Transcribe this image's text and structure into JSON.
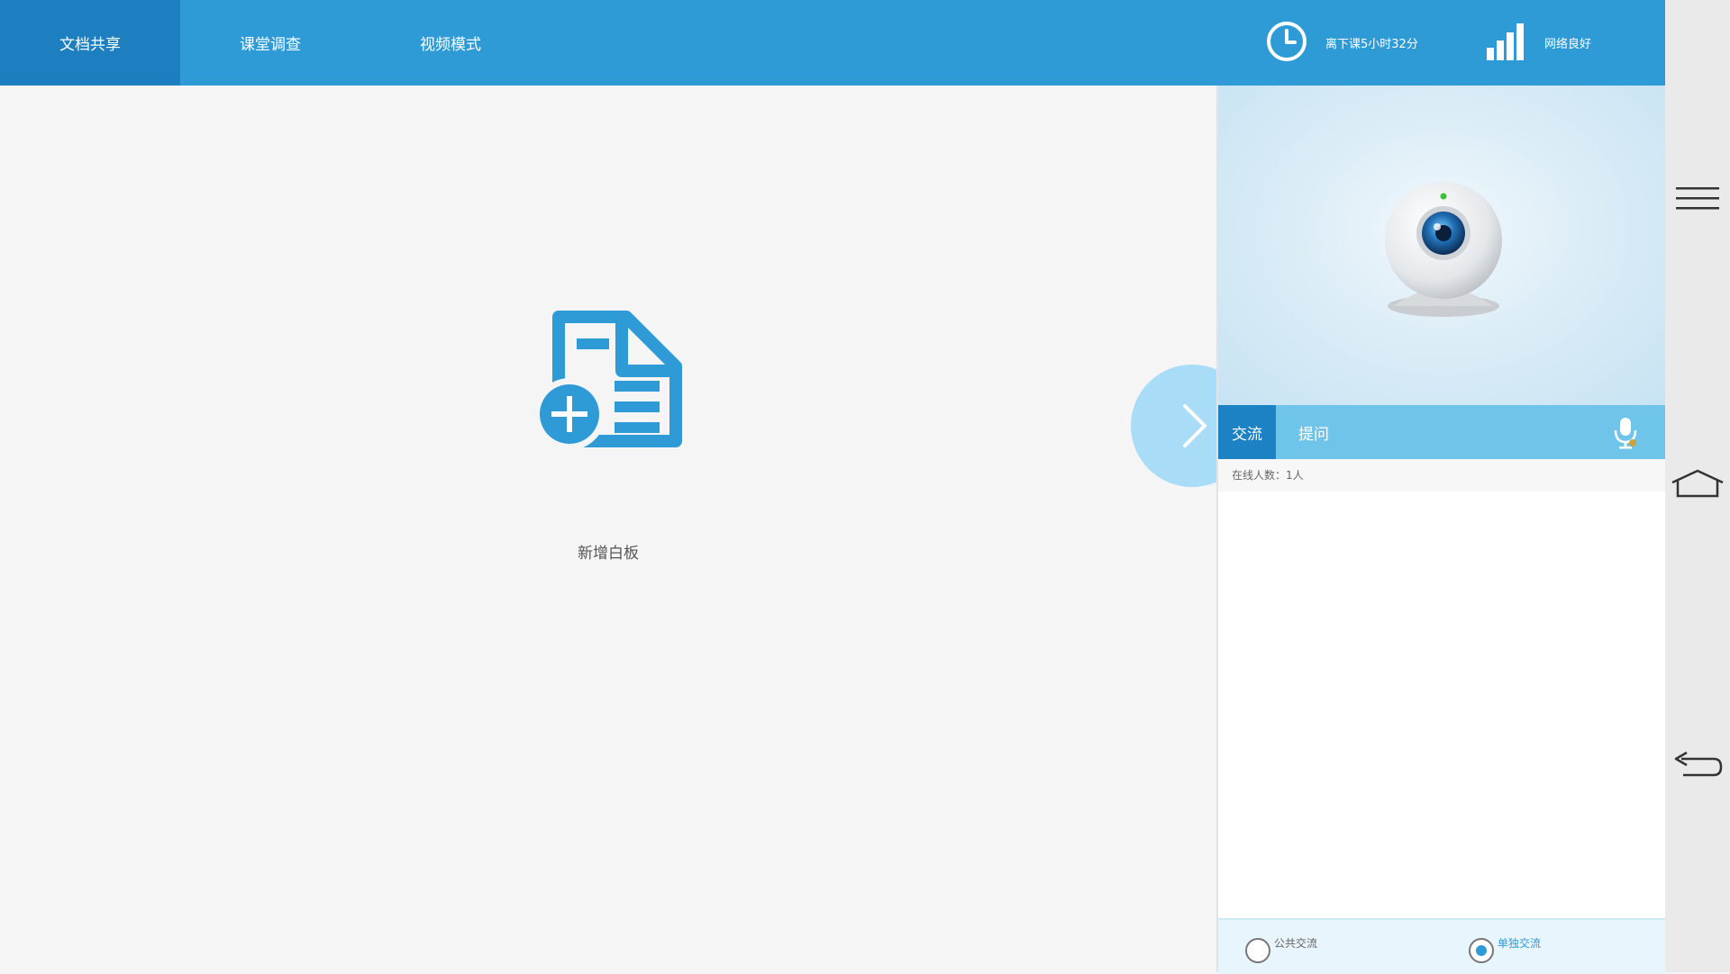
{
  "topbar": {
    "tabs": [
      {
        "label": "文档共享",
        "active": true
      },
      {
        "label": "课堂调查",
        "active": false
      },
      {
        "label": "视频模式",
        "active": false
      }
    ],
    "time_remaining": "离下课5小时32分",
    "network_status": "网络良好",
    "accent_color": "#2e9bd7",
    "active_tab_color": "#1d7fc0"
  },
  "main": {
    "new_board_label": "新增白板",
    "icons": {
      "new_board": "document-add-icon",
      "expand": "chevron-right-icon"
    }
  },
  "panel": {
    "video_icon": "webcam-icon",
    "chat_tabs": [
      {
        "label": "交流",
        "active": true
      },
      {
        "label": "提问",
        "active": false
      }
    ],
    "mic_icon": "microphone-icon",
    "online_count": "在线人数：1人",
    "mode_options": [
      {
        "label": "公共交流",
        "checked": false
      },
      {
        "label": "单独交流",
        "checked": true
      }
    ]
  },
  "sysnav": {
    "icons": [
      "menu-icon",
      "home-icon",
      "back-icon"
    ]
  }
}
